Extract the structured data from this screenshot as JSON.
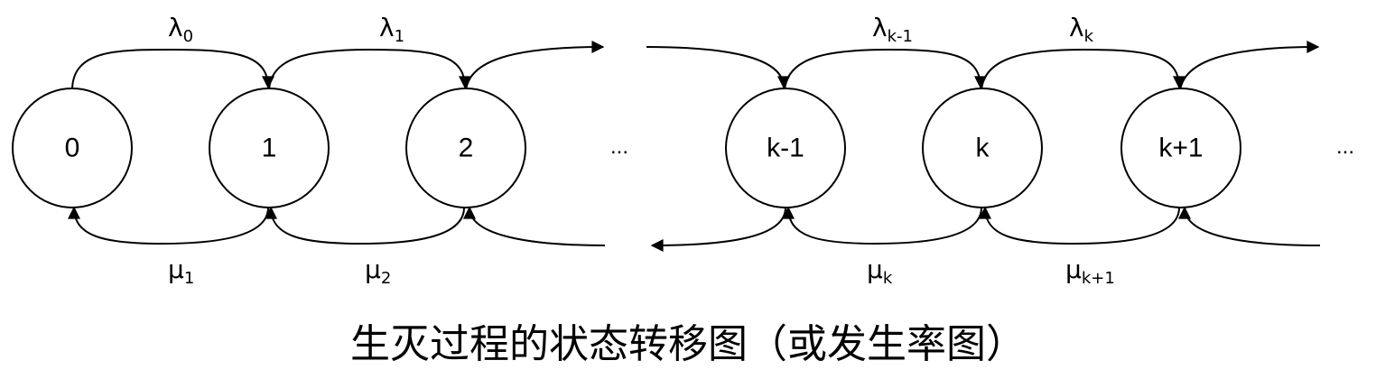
{
  "nodes": [
    "0",
    "1",
    "2",
    "k-1",
    "k",
    "k+1"
  ],
  "ellipsis": "...",
  "forward_rates": [
    {
      "symbol": "λ",
      "sub": "0"
    },
    {
      "symbol": "λ",
      "sub": "1"
    },
    {
      "symbol": "λ",
      "sub": "k-1"
    },
    {
      "symbol": "λ",
      "sub": "k"
    }
  ],
  "backward_rates": [
    {
      "symbol": "μ",
      "sub": "1"
    },
    {
      "symbol": "μ",
      "sub": "2"
    },
    {
      "symbol": "μ",
      "sub": "k"
    },
    {
      "symbol": "μ",
      "sub": "k+1"
    }
  ],
  "caption": "生灭过程的状态转移图（或发生率图）"
}
